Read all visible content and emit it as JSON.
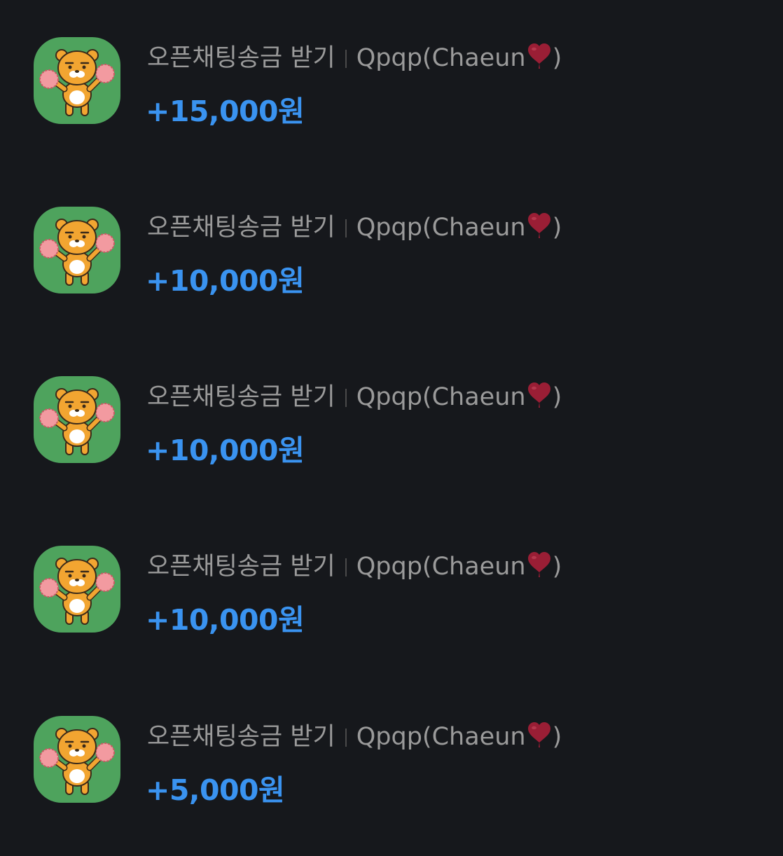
{
  "colors": {
    "background": "#16181c",
    "title_text": "#9a9a9a",
    "amount_text": "#3a93f0",
    "icon_bg": "#4ea35d",
    "heart": "#9a1e35"
  },
  "transactions": [
    {
      "type_label": "오픈채팅송금 받기",
      "sender_name": "Qpqp(Chaeun",
      "sender_suffix": ")",
      "sender_emoji": "heart-icon",
      "amount": "+15,000원",
      "icon": "ryan-cheerleader-icon"
    },
    {
      "type_label": "오픈채팅송금 받기",
      "sender_name": "Qpqp(Chaeun",
      "sender_suffix": ")",
      "sender_emoji": "heart-icon",
      "amount": "+10,000원",
      "icon": "ryan-cheerleader-icon"
    },
    {
      "type_label": "오픈채팅송금 받기",
      "sender_name": "Qpqp(Chaeun",
      "sender_suffix": ")",
      "sender_emoji": "heart-icon",
      "amount": "+10,000원",
      "icon": "ryan-cheerleader-icon"
    },
    {
      "type_label": "오픈채팅송금 받기",
      "sender_name": "Qpqp(Chaeun",
      "sender_suffix": ")",
      "sender_emoji": "heart-icon",
      "amount": "+10,000원",
      "icon": "ryan-cheerleader-icon"
    },
    {
      "type_label": "오픈채팅송금 받기",
      "sender_name": "Qpqp(Chaeun",
      "sender_suffix": ")",
      "sender_emoji": "heart-icon",
      "amount": "+5,000원",
      "icon": "ryan-cheerleader-icon"
    }
  ]
}
